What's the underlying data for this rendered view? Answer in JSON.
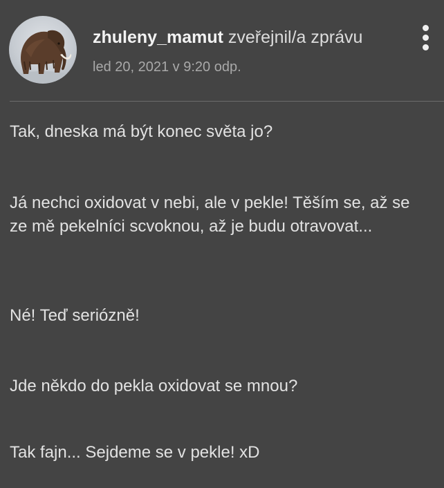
{
  "post": {
    "author": "zhuleny_mamut",
    "action": "zveřejnil/a zprávu",
    "timestamp": "led 20, 2021 v 9:20 odp.",
    "avatar_icon": "mammoth-avatar",
    "menu_icon": "more-vertical-icon",
    "paragraphs": [
      "Tak, dneska má být konec světa jo?",
      "Já nechci oxidovat v nebi, ale v pekle! Těším se, až se ze mě pekelníci scvoknou, až je budu otravovat...",
      "Né! Teď seriózně!",
      "Jde někdo do pekla oxidovat se mnou?",
      "Tak fajn... Sejdeme se v pekle! xD"
    ]
  },
  "colors": {
    "background": "#444444",
    "text": "#e2e2e2",
    "muted": "#a9a9a9",
    "divider": "#6b6b6b"
  }
}
